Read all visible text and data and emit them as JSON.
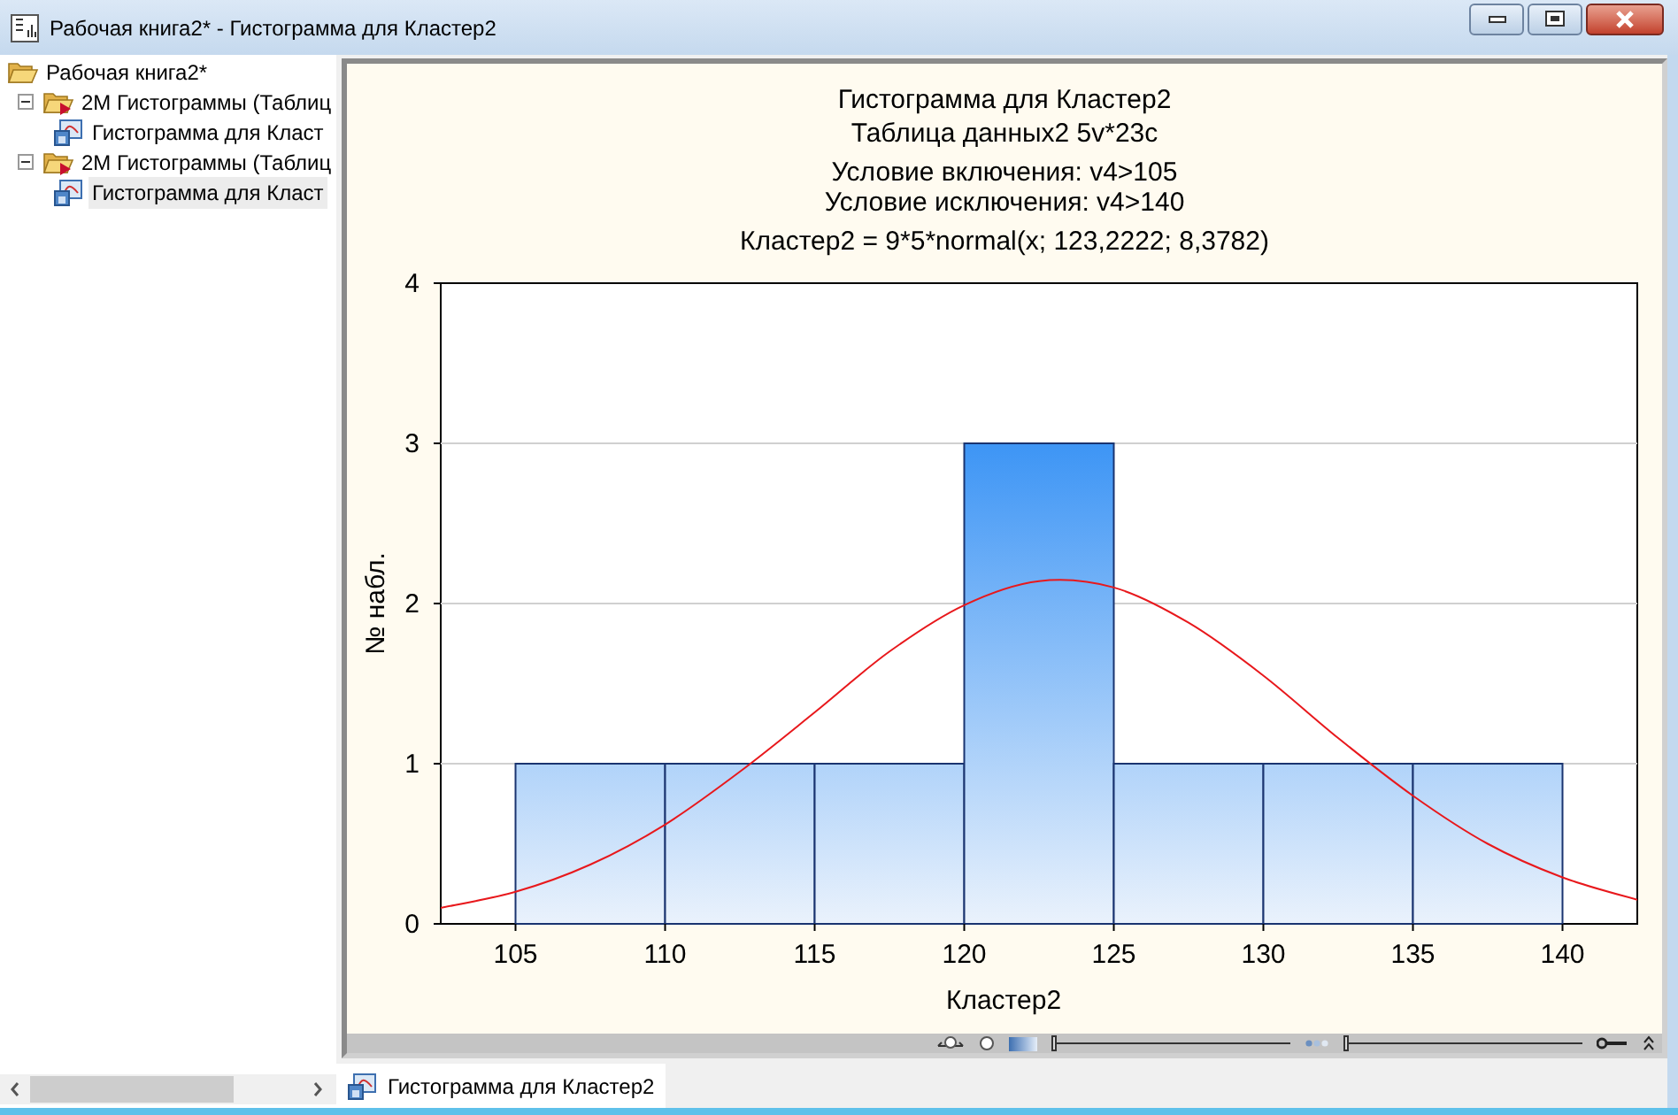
{
  "window": {
    "title": "Рабочая книга2* - Гистограмма для Кластер2"
  },
  "tree": [
    {
      "label": "Рабочая книга2*",
      "kind": "workbook",
      "selected": false,
      "children": [
        {
          "label": "2М Гистограммы (Таблиц",
          "kind": "folder",
          "selected": false,
          "children": [
            {
              "label": "Гистограмма для Класт",
              "kind": "graph",
              "selected": false
            }
          ]
        },
        {
          "label": "2М Гистограммы (Таблиц",
          "kind": "folder",
          "selected": false,
          "children": [
            {
              "label": "Гистограмма для Класт",
              "kind": "graph",
              "selected": true
            }
          ]
        }
      ]
    }
  ],
  "graph": {
    "titles": [
      "Гистограмма для Кластер2",
      "Таблица данных2 5v*23c",
      "Условие включения: v4>105",
      "Условие исключения: v4>140",
      "Кластер2 = 9*5*normal(x; 123,2222; 8,3782)"
    ],
    "chart_data": {
      "type": "bar",
      "grid": true,
      "xlabel": "Кластер2",
      "ylabel": "№ набл.",
      "xlim": [
        102.5,
        142.5
      ],
      "ylim": [
        0,
        4
      ],
      "xticks": [
        105,
        110,
        115,
        120,
        125,
        130,
        135,
        140
      ],
      "yticks": [
        0,
        1,
        2,
        3,
        4
      ],
      "x": [
        107.5,
        112.5,
        117.5,
        122.5,
        127.5,
        132.5,
        137.5
      ],
      "series": [
        {
          "type": "bar",
          "color": "#1a3470",
          "values": [
            1,
            1,
            1,
            3,
            1,
            1,
            1
          ]
        },
        {
          "type": "line",
          "color": "#e8181c",
          "x": [
            102.5,
            105,
            107.5,
            110,
            112.5,
            115,
            117.5,
            120,
            122.5,
            125,
            127.5,
            130,
            132.5,
            135,
            137.5,
            140,
            142.5
          ],
          "values": [
            0.1,
            0.2,
            0.37,
            0.62,
            0.95,
            1.32,
            1.7,
            1.99,
            2.14,
            2.1,
            1.88,
            1.55,
            1.16,
            0.8,
            0.5,
            0.29,
            0.15
          ]
        }
      ]
    },
    "zoom_sliders": [
      {
        "level": 0
      },
      {
        "level": 0
      }
    ]
  },
  "tabs": [
    {
      "label": "Гистограмма для Кластер2",
      "selected": true
    }
  ]
}
